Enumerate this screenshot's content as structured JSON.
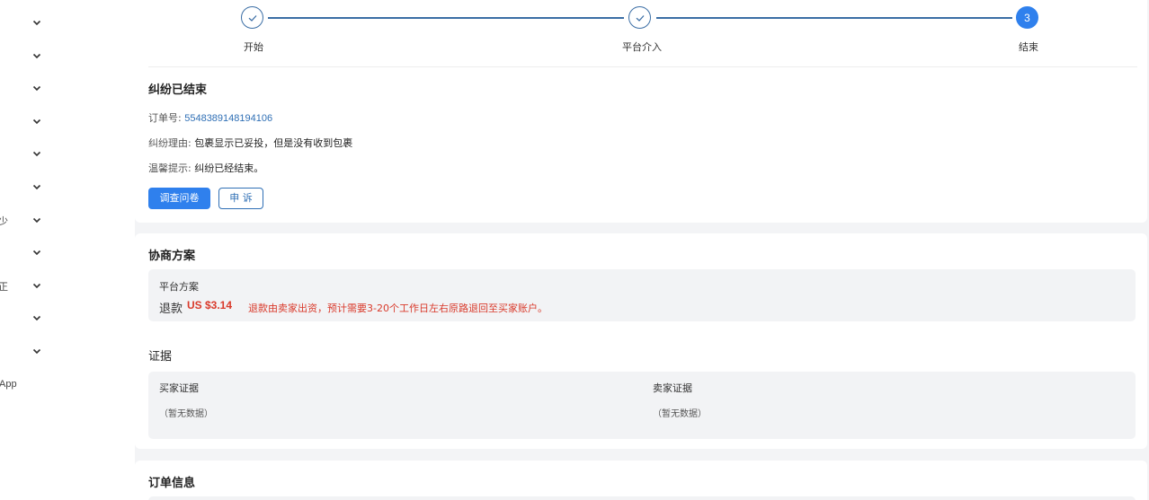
{
  "sidebar": {
    "items": [
      {
        "fragment": ""
      },
      {
        "fragment": ""
      },
      {
        "fragment": ""
      },
      {
        "fragment": ""
      },
      {
        "fragment": ""
      },
      {
        "fragment": ""
      },
      {
        "fragment": "少"
      },
      {
        "fragment": ""
      },
      {
        "fragment": "正"
      },
      {
        "fragment": ""
      },
      {
        "fragment": ""
      }
    ],
    "app_label": "App",
    "chevron_icon": "chevron-down-icon"
  },
  "steps": [
    {
      "label": "开始",
      "state": "done"
    },
    {
      "label": "平台介入",
      "state": "done"
    },
    {
      "label": "结束",
      "state": "active",
      "number": "3"
    }
  ],
  "dispute": {
    "title": "纠纷已结束",
    "order_no_label": "订单号:",
    "order_no": "5548389148194106",
    "reason_label": "纠纷理由:",
    "reason": "包裹显示已妥投，但是没有收到包裹",
    "tip_label": "温馨提示:",
    "tip": "纠纷已经结束。",
    "survey_button": "调查问卷",
    "appeal_button": "申 诉"
  },
  "plan": {
    "title": "协商方案",
    "platform_label": "平台方案",
    "refund_label": "退款",
    "refund_amount": "US $3.14",
    "refund_note": "退款由卖家出资，预计需要3-20个工作日左右原路退回至买家账户。",
    "accent_color": "#d93a2b"
  },
  "evidence": {
    "title": "证据",
    "buyer_label": "买家证据",
    "buyer_value": "（暂无数据）",
    "seller_label": "卖家证据",
    "seller_value": "（暂无数据）"
  },
  "order_info": {
    "title": "订单信息"
  },
  "colors": {
    "primary": "#2f80ed",
    "line": "#3b6ea5",
    "background": "#f3f4f6"
  }
}
